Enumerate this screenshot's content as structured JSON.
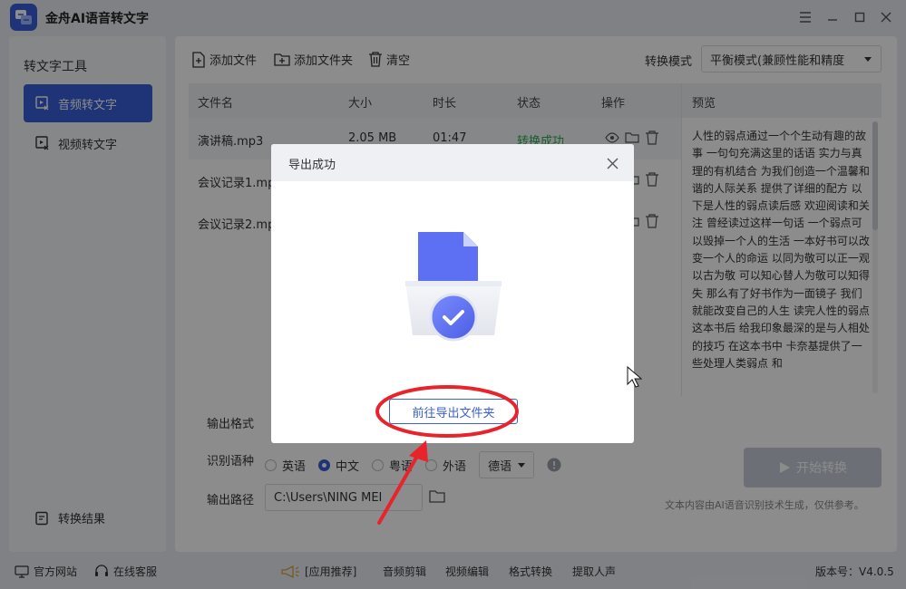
{
  "app": {
    "title": "金舟AI语音转文字"
  },
  "sidebar": {
    "title": "转文字工具",
    "items": [
      {
        "label": "音频转文字"
      },
      {
        "label": "视频转文字"
      }
    ],
    "result_label": "转换结果"
  },
  "toolbar": {
    "add_file": "添加文件",
    "add_folder": "添加文件夹",
    "clear": "清空",
    "mode_label": "转换模式",
    "mode_value": "平衡模式(兼顾性能和精度"
  },
  "table": {
    "headers": [
      "文件名",
      "大小",
      "时长",
      "状态",
      "操作"
    ],
    "rows": [
      {
        "name": "演讲稿.mp3",
        "size": "2.05 MB",
        "duration": "01:47",
        "status": "转换成功"
      },
      {
        "name": "会议记录1.mp",
        "size": "",
        "duration": "",
        "status": ""
      },
      {
        "name": "会议记录2.mp",
        "size": "",
        "duration": "",
        "status": ""
      }
    ]
  },
  "preview": {
    "title": "预览",
    "text": "人性的弱点通过一个个生动有趣的故事 一句句充满这里的话语 实力与真理的有机结合 为我们创造一个温馨和谐的人际关系 提供了详细的配方 以下是人性的弱点读后感 欢迎阅读和关注 曾经读过这样一句话 一个弱点可以毁掉一个人的生活 一本好书可以改变一个人的命运 以同为敬可以正一观以古为敬 可以知心替人为敬可以知得失 那么有了好书作为一面镜子 我们就能改变自己的人生 读完人性的弱点这本书后 给我印象最深的是与人相处的技巧 在这本书中 卡奈基提供了一些处理人类弱点 和"
  },
  "options": {
    "format_label": "输出格式",
    "lang_label": "识别语种",
    "langs": [
      "英语",
      "中文",
      "粤语",
      "外语"
    ],
    "lang_selected": "中文",
    "foreign_value": "德语",
    "path_label": "输出路径",
    "path_value": "C:\\Users\\NING MEI"
  },
  "actions": {
    "start": "开始转换",
    "disclaimer": "文本内容由AI语音识别技术生成，仅供参考。"
  },
  "footer": {
    "website": "官方网站",
    "support": "在线客服",
    "apps": "[应用推荐]",
    "audio_edit": "音频剪辑",
    "video_edit": "视频编辑",
    "format_convert": "格式转换",
    "extract_voice": "提取人声",
    "version": "版本号：V4.0.5"
  },
  "modal": {
    "title": "导出成功",
    "button": "前往导出文件夹"
  },
  "colors": {
    "accent": "#3a5fd7",
    "success": "#2daa4f",
    "annotation": "#e8232b"
  }
}
